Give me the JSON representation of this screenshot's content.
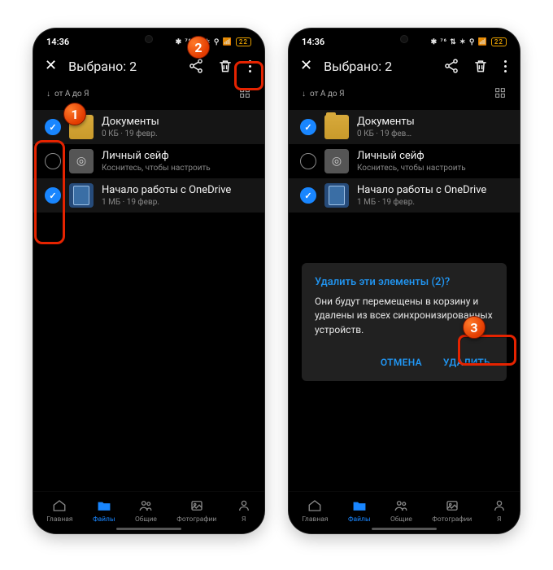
{
  "status": {
    "time": "14:36",
    "battery": "22"
  },
  "appbar": {
    "title": "Выбрано: 2"
  },
  "sort": {
    "label": "от А до Я"
  },
  "files": [
    {
      "name": "Документы",
      "meta": "0 КБ · 19 февр.",
      "selected": true,
      "kind": "folder"
    },
    {
      "name": "Личный сейф",
      "meta": "Коснитесь, чтобы настроить",
      "selected": false,
      "kind": "vault"
    },
    {
      "name": "Начало работы с OneDrive",
      "meta": "1 МБ · 19 февр.",
      "selected": true,
      "kind": "doc"
    }
  ],
  "files_right_meta_0": "0 КБ · 19 фев…",
  "nav": {
    "home": "Главная",
    "files": "Файлы",
    "shared": "Общие",
    "photos": "Фотографии",
    "me": "Я"
  },
  "dialog": {
    "title": "Удалить эти элементы (2)?",
    "body": "Они будут перемещены в корзину и удалены из всех синхронизированных устройств.",
    "cancel": "ОТМЕНА",
    "confirm": "УДАЛИТЬ"
  },
  "callouts": {
    "c1": "1",
    "c2": "2",
    "c3": "3"
  }
}
